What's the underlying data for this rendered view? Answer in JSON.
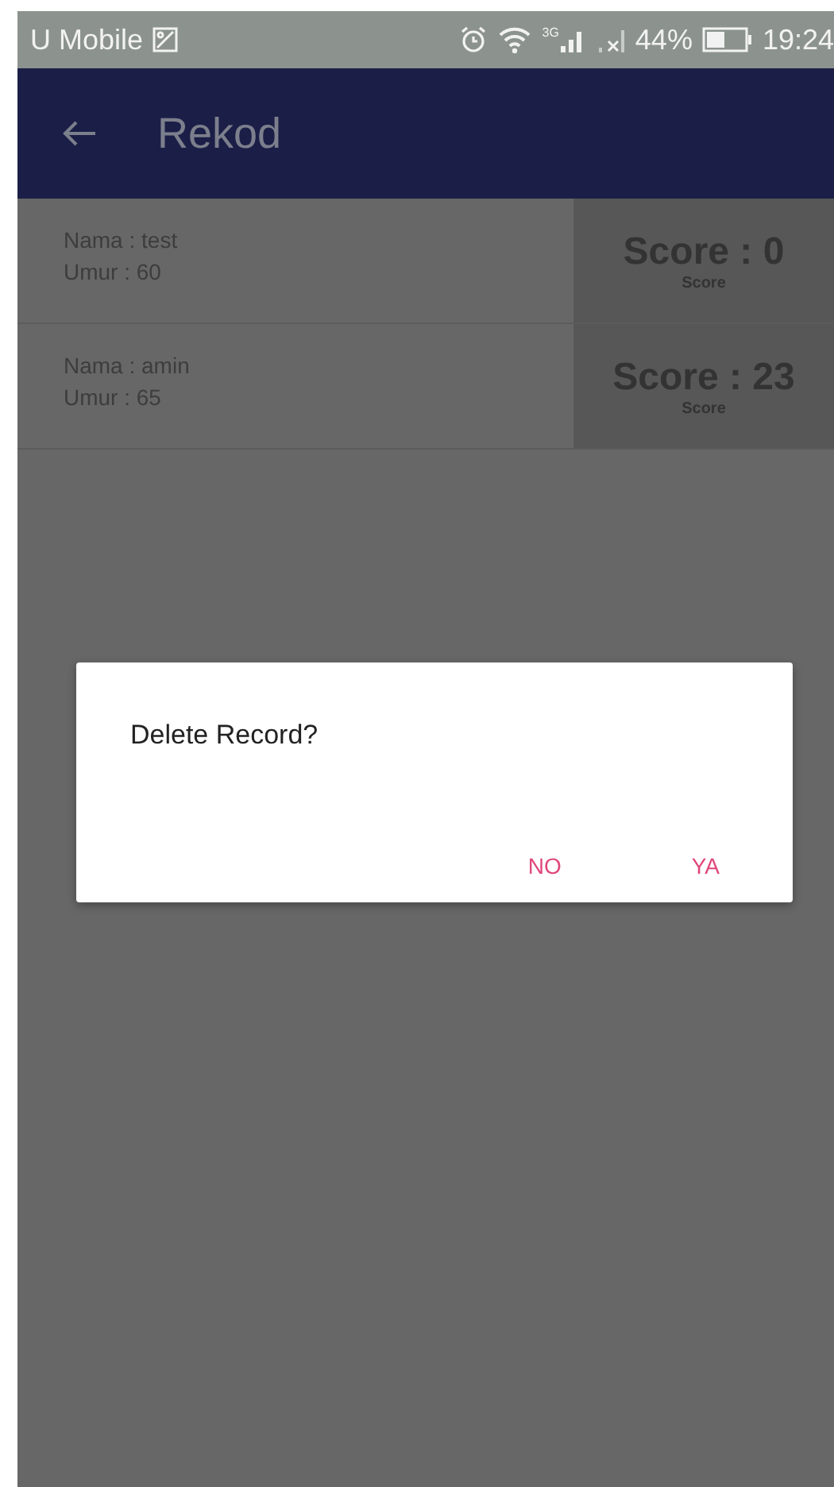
{
  "status_bar": {
    "carrier": "U Mobile",
    "network": "3G",
    "battery": "44%",
    "time": "19:24"
  },
  "app_bar": {
    "title": "Rekod"
  },
  "records": [
    {
      "name": "Nama : test",
      "age": "Umur : 60",
      "score": "Score : 0",
      "caption": "Score"
    },
    {
      "name": "Nama : amin",
      "age": "Umur : 65",
      "score": "Score : 23",
      "caption": "Score"
    }
  ],
  "dialog": {
    "message": "Delete Record?",
    "buttons": [
      "NO",
      "YA"
    ]
  }
}
